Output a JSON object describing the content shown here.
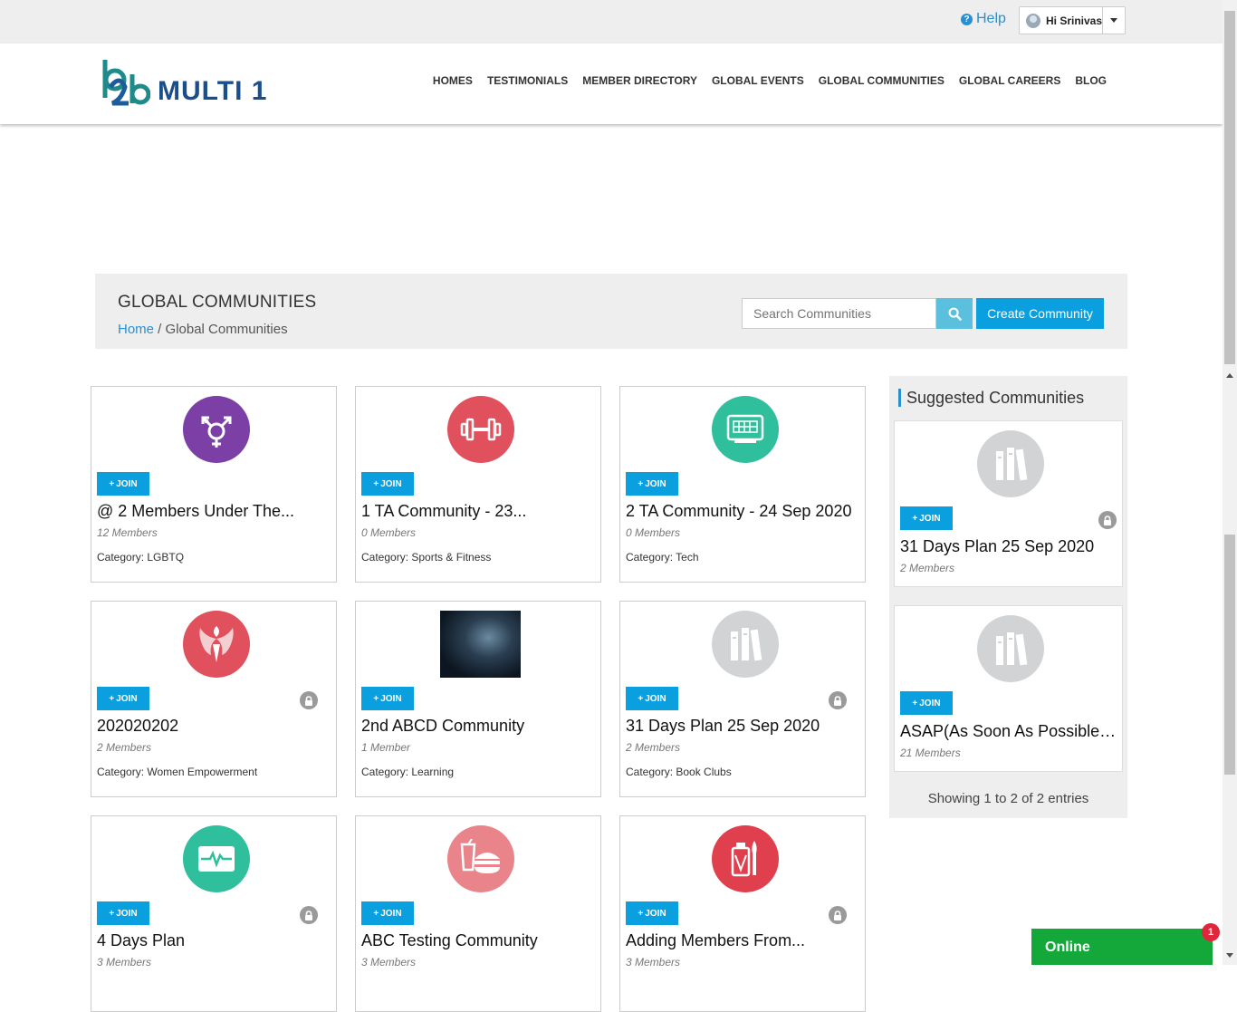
{
  "header": {
    "help_label": "Help",
    "user_greeting": "Hi Srinivas"
  },
  "logo": {
    "mark": "b2b",
    "text": "MULTI 1"
  },
  "nav": [
    {
      "label": "HOMES"
    },
    {
      "label": "TESTIMONIALS"
    },
    {
      "label": "MEMBER DIRECTORY"
    },
    {
      "label": "GLOBAL EVENTS"
    },
    {
      "label": "GLOBAL COMMUNITIES"
    },
    {
      "label": "GLOBAL CAREERS"
    },
    {
      "label": "BLOG"
    }
  ],
  "page": {
    "title": "GLOBAL COMMUNITIES",
    "breadcrumb_home": "Home",
    "breadcrumb_sep": " / ",
    "breadcrumb_current": "Global Communities",
    "search_placeholder": "Search Communities",
    "create_label": "Create Community"
  },
  "join_label": "JOIN",
  "communities": [
    {
      "title": "@ 2 Members Under The...",
      "members": "12 Members",
      "category": "Category: LGBTQ",
      "icon": "transgender-icon",
      "color": "#7b3fa6",
      "locked": false
    },
    {
      "title": "1 TA Community - 23...",
      "members": "0 Members",
      "category": "Category: Sports & Fitness",
      "icon": "dumbbell-icon",
      "color": "#e0505d",
      "locked": false
    },
    {
      "title": "2 TA Community - 24 Sep 2020",
      "members": "0 Members",
      "category": "Category: Tech",
      "icon": "keyboard-icon",
      "color": "#2fbf9c",
      "locked": false
    },
    {
      "title": "202020202",
      "members": "2 Members",
      "category": "Category: Women Empowerment",
      "icon": "women-empowerment-icon",
      "color": "#e0505d",
      "locked": true
    },
    {
      "title": "2nd ABCD Community",
      "members": "1 Member",
      "category": "Category: Learning",
      "icon": "space-photo",
      "color": "#1a2a3a",
      "locked": false
    },
    {
      "title": "31 Days Plan 25 Sep 2020",
      "members": "2 Members",
      "category": "Category: Book Clubs",
      "icon": "books-icon",
      "color": "#d2d3d5",
      "locked": true
    },
    {
      "title": "4 Days Plan",
      "members": "3 Members",
      "category": "",
      "icon": "heartbeat-monitor-icon",
      "color": "#2fbf9c",
      "locked": true
    },
    {
      "title": "ABC Testing Community",
      "members": "3 Members",
      "category": "",
      "icon": "food-icon",
      "color": "#e8848a",
      "locked": false
    },
    {
      "title": "Adding Members From...",
      "members": "3 Members",
      "category": "",
      "icon": "beauty-icon",
      "color": "#e0404d",
      "locked": true
    }
  ],
  "suggested": {
    "title": "Suggested Communities",
    "items": [
      {
        "title": "31 Days Plan 25 Sep 2020",
        "members": "2 Members",
        "icon": "books-icon",
        "locked": true
      },
      {
        "title": "ASAP(As Soon As Possible)...",
        "members": "21 Members",
        "icon": "books-icon",
        "locked": false
      }
    ],
    "showing": "Showing 1 to 2 of 2 entries"
  },
  "chat": {
    "label": "Online",
    "badge": "1"
  }
}
